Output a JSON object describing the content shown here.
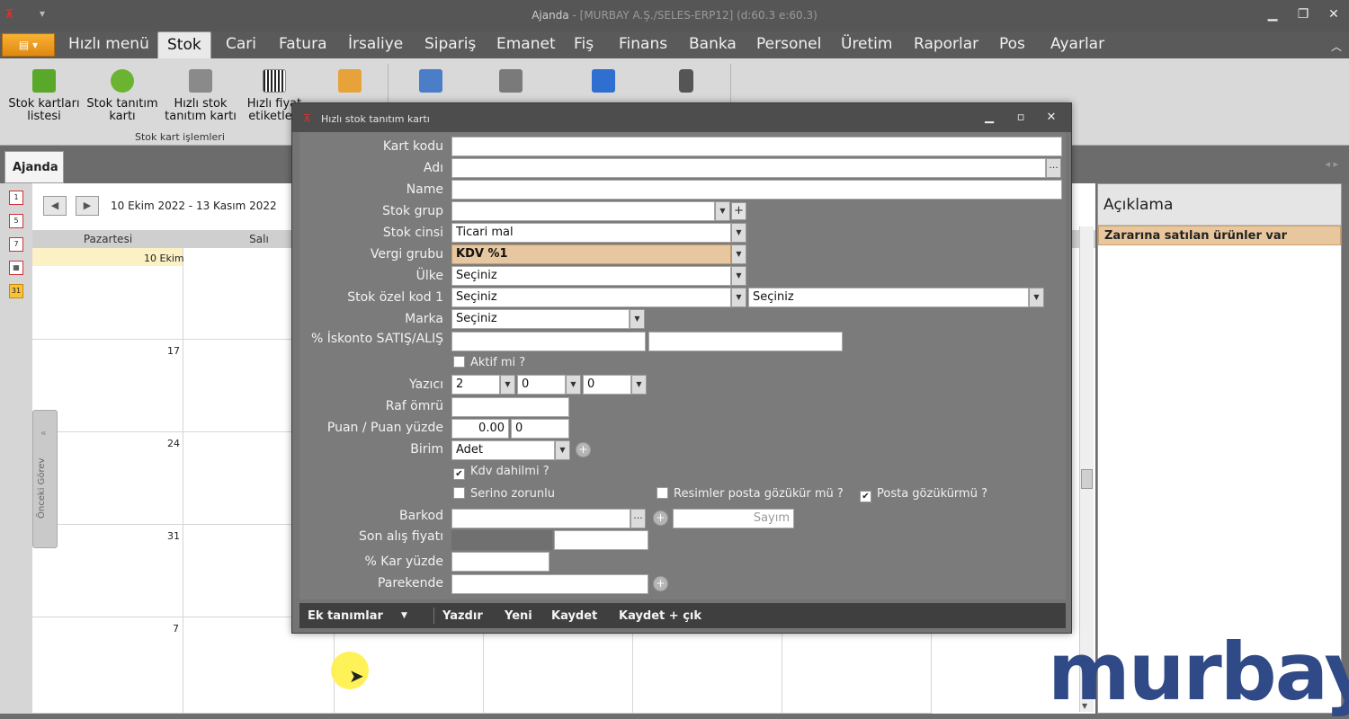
{
  "window": {
    "title": "Ajanda",
    "subtitle": " - [MURBAY A.Ş./SELES-ERP12] (d:60.3 e:60.3)"
  },
  "menu": {
    "app_button": "▤ ▾",
    "tabs": [
      "Hızlı menü",
      "Stok",
      "Cari",
      "Fatura",
      "İrsaliye",
      "Sipariş",
      "Emanet",
      "Fiş",
      "Finans",
      "Banka",
      "Personel",
      "Üretim",
      "Raporlar",
      "Pos",
      "Ayarlar"
    ],
    "active_tab": "Stok"
  },
  "ribbon": {
    "buttons": [
      {
        "label1": "Stok kartları",
        "label2": "listesi",
        "color": "#5aa82a"
      },
      {
        "label1": "Stok tanıtım",
        "label2": "kartı",
        "color": "#6ab432"
      },
      {
        "label1": "Hızlı stok",
        "label2": "tanıtım kartı",
        "color": "#8a8a8a"
      },
      {
        "label1": "Hızlı fiyat",
        "label2": "etiketleri",
        "color": "#dcdcdc"
      }
    ],
    "group_label": "Stok kart işlemleri",
    "extra_icon_colors": [
      "#e8a23a",
      "#4a7ec8",
      "#7a7a7a",
      "#2e6fd0",
      "#555555"
    ]
  },
  "doc_tab": "Ajanda",
  "calendar": {
    "date_range": "10 Ekim 2022 - 13 Kasım 2022",
    "day_headers": [
      "Pazartesi",
      "Salı"
    ],
    "week_labels": [
      "10 Ekim",
      "17",
      "24",
      "31",
      "7"
    ],
    "side_tab": "Önceki Görev",
    "icons": [
      "1",
      "5",
      "7",
      "▦",
      "31"
    ]
  },
  "right_panel": {
    "header": "Açıklama",
    "note": "Zararına satılan ürünler var"
  },
  "logo": "murbay",
  "dialog": {
    "title": "Hızlı stok tanıtım kartı",
    "labels": {
      "kart_kodu": "Kart kodu",
      "adi": "Adı",
      "name": "Name",
      "stok_grup": "Stok grup",
      "stok_cinsi": "Stok cinsi",
      "vergi_grubu": "Vergi grubu",
      "ulke": "Ülke",
      "stok_ozel_kod": "Stok özel kod 1",
      "marka": "Marka",
      "iskonto": "% İskonto SATIŞ/ALIŞ",
      "yazici": "Yazıcı",
      "raf_omru": "Raf ömrü",
      "puan": "Puan / Puan yüzde",
      "birim": "Birim",
      "barkod": "Barkod",
      "son_alis": "Son alış fiyatı",
      "kar_yuzde": "% Kar yüzde",
      "parekende": "Parekende"
    },
    "values": {
      "kart_kodu": "",
      "adi": "",
      "name": "",
      "stok_grup": "",
      "stok_cinsi": "Ticari mal",
      "vergi_grubu": "KDV %1",
      "ulke": "Seçiniz",
      "stok_ozel_kod_1": "Seçiniz",
      "stok_ozel_kod_2": "Seçiniz",
      "marka": "Seçiniz",
      "iskonto_satis": "",
      "iskonto_alis": "",
      "yazici_1": "2",
      "yazici_2": "0",
      "yazici_3": "0",
      "raf_omru": "",
      "puan": "0.00",
      "puan_yuzde": "0",
      "birim": "Adet",
      "barkod": "",
      "sayim_placeholder": "Sayım",
      "son_alis": "",
      "kar_yuzde": "",
      "parekende": ""
    },
    "checkboxes": {
      "aktif": {
        "label": "Aktif mi ?",
        "checked": false
      },
      "kdv_dahil": {
        "label": "Kdv dahilmi ?",
        "checked": true
      },
      "serino": {
        "label": "Serino zorunlu",
        "checked": false
      },
      "resimler": {
        "label": "Resimler posta gözükür mü ?",
        "checked": false
      },
      "posta": {
        "label": "Posta gözükürmü ?",
        "checked": true
      }
    },
    "footer": {
      "ek_tanimlar": "Ek tanımlar",
      "yazdir": "Yazdır",
      "yeni": "Yeni",
      "kaydet": "Kaydet",
      "kaydet_cik": "Kaydet + çık"
    }
  }
}
